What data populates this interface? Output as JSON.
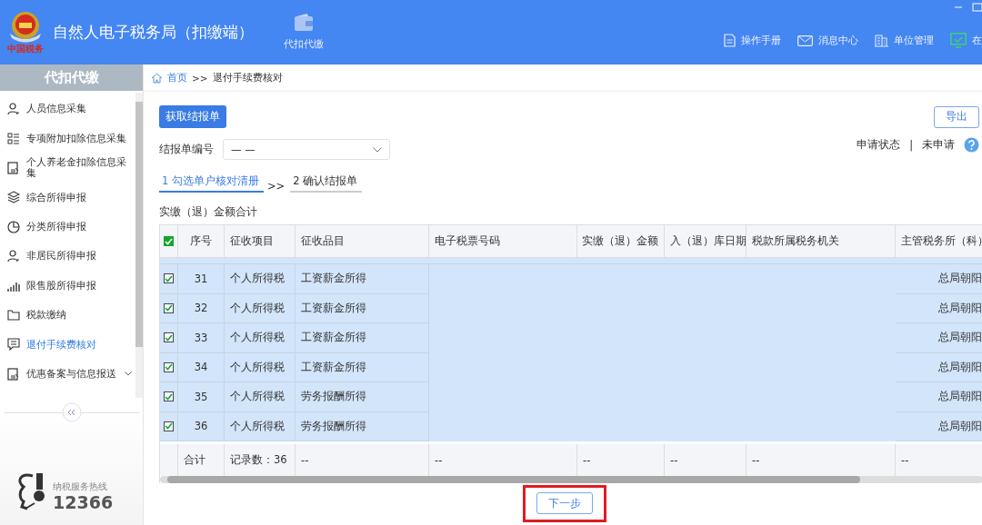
{
  "app": {
    "emblem_text": "中国税务",
    "title": "自然人电子税务局（扣缴端）",
    "nav": [
      {
        "label": "代扣代缴"
      }
    ],
    "tools": [
      {
        "label": "操作手册"
      },
      {
        "label": "消息中心"
      },
      {
        "label": "单位管理"
      },
      {
        "label": "在"
      }
    ]
  },
  "sidebar": {
    "title": "代扣代缴",
    "items": [
      {
        "label": "人员信息采集",
        "selected": false,
        "expandable": false
      },
      {
        "label": "专项附加扣除信息采集",
        "selected": false,
        "expandable": false
      },
      {
        "label": "个人养老金扣除信息采集",
        "selected": false,
        "expandable": false
      },
      {
        "label": "综合所得申报",
        "selected": false,
        "expandable": false
      },
      {
        "label": "分类所得申报",
        "selected": false,
        "expandable": false
      },
      {
        "label": "非居民所得申报",
        "selected": false,
        "expandable": false
      },
      {
        "label": "限售股所得申报",
        "selected": false,
        "expandable": false
      },
      {
        "label": "税款缴纳",
        "selected": false,
        "expandable": false
      },
      {
        "label": "退付手续费核对",
        "selected": true,
        "expandable": false
      },
      {
        "label": "优惠备案与信息报送",
        "selected": false,
        "expandable": true
      }
    ],
    "hotline": {
      "label": "纳税服务热线",
      "number": "12366"
    }
  },
  "breadcrumb": {
    "home": "首页",
    "sep": ">>",
    "current": "退付手续费核对"
  },
  "buttons": {
    "fetch": "获取结报单",
    "export": "导出",
    "next": "下一步"
  },
  "report_no": {
    "label": "结报单编号",
    "value": "— —"
  },
  "status": {
    "label": "申请状态",
    "sep": "|",
    "value": "未申请"
  },
  "steps": [
    {
      "label": "1 勾选单户核对清册",
      "selected": true
    },
    {
      "label": "2 确认结报单",
      "selected": false
    }
  ],
  "step_sep": ">>",
  "total_label": "实缴（退）金额合计",
  "table": {
    "all_checked": true,
    "columns": [
      "序号",
      "征收项目",
      "征收品目",
      "电子税票号码",
      "实缴（退）金额",
      "入（退）库日期",
      "税款所属税务机关",
      "主管税务所（科）"
    ],
    "rows": [
      {
        "checked": true,
        "no": "31",
        "item": "个人所得税",
        "category": "工资薪金所得",
        "office": "总局朝阳"
      },
      {
        "checked": true,
        "no": "32",
        "item": "个人所得税",
        "category": "工资薪金所得",
        "office": "总局朝阳"
      },
      {
        "checked": true,
        "no": "33",
        "item": "个人所得税",
        "category": "工资薪金所得",
        "office": "总局朝阳"
      },
      {
        "checked": true,
        "no": "34",
        "item": "个人所得税",
        "category": "工资薪金所得",
        "office": "总局朝阳"
      },
      {
        "checked": true,
        "no": "35",
        "item": "个人所得税",
        "category": "劳务报酬所得",
        "office": "总局朝阳"
      },
      {
        "checked": true,
        "no": "36",
        "item": "个人所得税",
        "category": "劳务报酬所得",
        "office": "总局朝阳"
      }
    ],
    "footer": [
      "合计",
      "记录数：36",
      "--",
      "--",
      "--",
      "--",
      "--",
      "--"
    ]
  }
}
